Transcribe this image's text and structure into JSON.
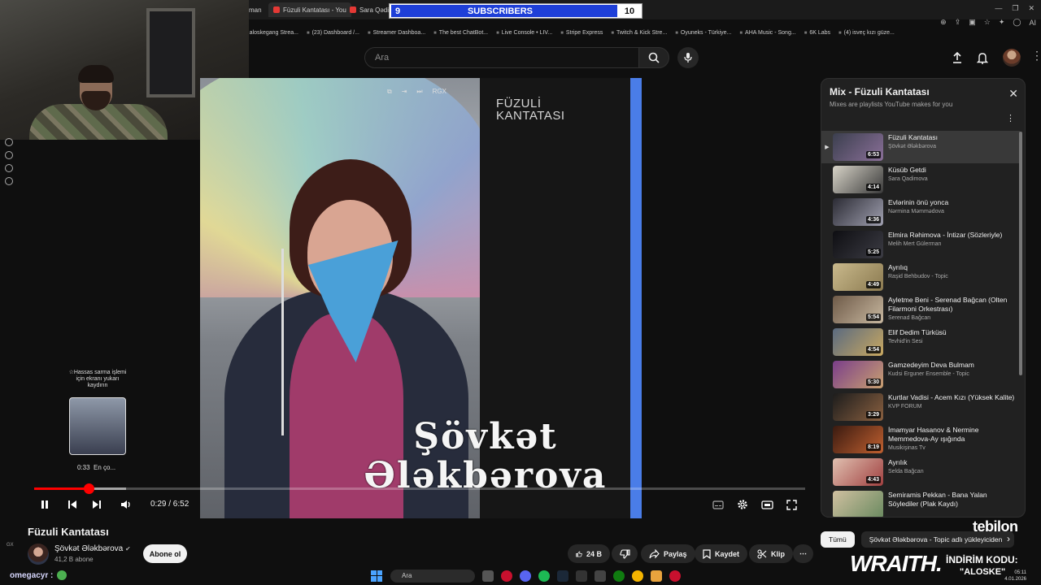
{
  "browser": {
    "tabs": [
      {
        "label": "man"
      },
      {
        "label": "Füzuli Kantatası - You"
      },
      {
        "label": "Sara Qədimo"
      }
    ],
    "bookmarks": [
      "aloskegang Strea...",
      "(23) Dashboard /...",
      "Streamer Dashboa...",
      "The best ChatBot...",
      "Live Console • LIV...",
      "Stripe Express",
      "Twitch & Kick Stre...",
      "Oyuneks - Türkiye...",
      "AHA Music - Song...",
      "6K Labs",
      "(4) isveç kızı güze..."
    ],
    "ai_label": "AI"
  },
  "sub_counter": {
    "left_num": "9",
    "label": "SUBSCRIBERS",
    "right_num": "10"
  },
  "header": {
    "search_placeholder": "Ara"
  },
  "video": {
    "poster_title": "FÜZULİ KANTATASI",
    "poster_name": "Şövkət Ələkbərova",
    "top_label": "RGX",
    "hover_hint": "☆Hassas sarma işlemi için ekranı yukarı kaydırın",
    "preview_time": "0:33",
    "preview_chapter": "En ço...",
    "time_display": "0:29 / 6:52",
    "progress_fraction": 0.0704
  },
  "info": {
    "title": "Füzuli Kantatası",
    "channel": "Şövkət Ələkbərova",
    "subscribers": "41,2 B abone",
    "subscribe": "Abone ol",
    "likes": "24 B",
    "share": "Paylaş",
    "save": "Kaydet",
    "clip": "Klip"
  },
  "playlist": {
    "title": "Mix - Füzuli Kantatası",
    "subtitle": "Mixes are playlists YouTube makes for you",
    "items": [
      {
        "title": "Füzuli Kantatası",
        "channel": "Şövkət Ələkbərova",
        "duration": "6:53",
        "active": true,
        "thumb": [
          "#3b3f4e",
          "#8a6f98"
        ]
      },
      {
        "title": "Küsüb Getdi",
        "channel": "Sara Qadimova",
        "duration": "4:14",
        "thumb": [
          "#d8d4c8",
          "#3a3a3a"
        ]
      },
      {
        "title": "Evlərinin önü yonca",
        "channel": "Nərmina Məmmədova",
        "duration": "4:36",
        "thumb": [
          "#2b2b34",
          "#a0a0b0"
        ]
      },
      {
        "title": "Elmira Rəhimova - İntizar (Sözleriyle)",
        "channel": "Melih Mert Gülerman",
        "duration": "5:25",
        "thumb": [
          "#0e0e12",
          "#3c3c44"
        ]
      },
      {
        "title": "Ayrılıq",
        "channel": "Raşid Behbudov - Topic",
        "duration": "4:49",
        "thumb": [
          "#c9b98c",
          "#8b7a50"
        ]
      },
      {
        "title": "Ayletme Beni - Serenad Bağcan (Olten Filarmoni Orkestrası)",
        "channel": "Serenad Bağcan",
        "duration": "5:54",
        "thumb": [
          "#6e5a48",
          "#c8b8a0"
        ]
      },
      {
        "title": "Elif Dedim Türküsü",
        "channel": "Tevhid'in Sesi",
        "duration": "4:54",
        "thumb": [
          "#5a6a80",
          "#c9a860"
        ]
      },
      {
        "title": "Gamzedeyim Deva Bulmam",
        "channel": "Kudsi Erguner Ensemble - Topic",
        "duration": "5:30",
        "thumb": [
          "#7a3e8a",
          "#c9a070"
        ]
      },
      {
        "title": "Kurtlar Vadisi - Acem Kızı (Yüksek Kalite)",
        "channel": "KVP FORUM",
        "duration": "3:29",
        "thumb": [
          "#1c1c1c",
          "#8a6040"
        ]
      },
      {
        "title": "İmamyar Hasanov & Nermine Memmedova-Ay ışığında",
        "channel": "Musikişinas Tv",
        "duration": "8:19",
        "thumb": [
          "#3a1a10",
          "#c06030"
        ]
      },
      {
        "title": "Ayrılık",
        "channel": "Selda Bağcan",
        "duration": "4:43",
        "thumb": [
          "#e0c0b0",
          "#a04040"
        ]
      },
      {
        "title": "Semiramis Pekkan - Bana Yalan Söylediler (Plak Kaydı)",
        "channel": "",
        "duration": "",
        "thumb": [
          "#d0c0a0",
          "#6a8a60"
        ]
      }
    ]
  },
  "chips": [
    "Tümü",
    "Şövkət Ələkbərova - Topic adlı yükleyiciden"
  ],
  "chat": {
    "user": "omegacyr :"
  },
  "overlays": {
    "brand1": "tebilon",
    "brand2": "WRAITH.",
    "promo": "İNDİRİM KODU:",
    "code": "\"ALOSKE\"",
    "gx": "GX"
  },
  "taskbar": {
    "search": "Ara",
    "time": "05:11",
    "date": "4.01.2026"
  }
}
